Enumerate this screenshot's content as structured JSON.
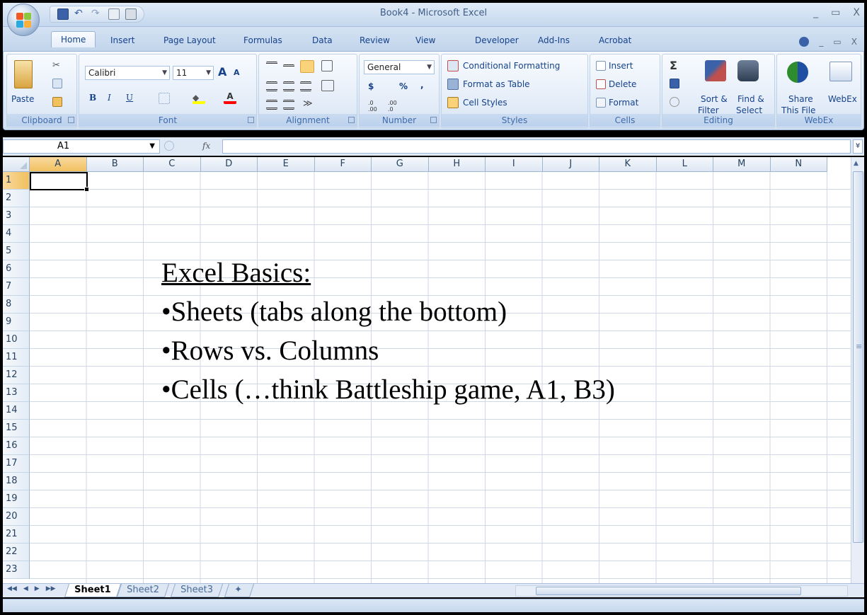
{
  "window": {
    "title": "Book4 - Microsoft Excel",
    "controls": [
      "_",
      "▭",
      "X"
    ]
  },
  "qat": {
    "icons": [
      "save-icon",
      "undo-icon",
      "redo-icon",
      "print-preview-icon",
      "quick-print-icon"
    ]
  },
  "tabs": [
    "Home",
    "Insert",
    "Page Layout",
    "Formulas",
    "Data",
    "Review",
    "View",
    "Developer",
    "Add-Ins",
    "Acrobat"
  ],
  "active_tab": "Home",
  "ribbon": {
    "clipboard": {
      "paste": "Paste",
      "label": "Clipboard"
    },
    "font": {
      "name": "Calibri",
      "size": "11",
      "label": "Font",
      "bold": "B",
      "italic": "I",
      "underline": "U",
      "grow": "A",
      "shrink": "A"
    },
    "alignment": {
      "label": "Alignment"
    },
    "number": {
      "format": "General",
      "label": "Number",
      "currency": "$",
      "percent": "%",
      "comma": ","
    },
    "styles": {
      "conditional": "Conditional Formatting",
      "format_table": "Format as Table",
      "cell_styles": "Cell Styles",
      "label": "Styles"
    },
    "cells": {
      "insert": "Insert",
      "delete": "Delete",
      "format": "Format",
      "label": "Cells"
    },
    "editing": {
      "sum": "Σ",
      "sort": "Sort &",
      "sort2": "Filter",
      "find": "Find &",
      "find2": "Select",
      "label": "Editing"
    },
    "webex": {
      "share": "Share",
      "share2": "This File",
      "webex": "WebEx",
      "label": "WebEx"
    }
  },
  "formula_bar": {
    "name_box": "A1",
    "fx": "fx",
    "value": ""
  },
  "columns": [
    "A",
    "B",
    "C",
    "D",
    "E",
    "F",
    "G",
    "H",
    "I",
    "J",
    "K",
    "L",
    "M",
    "N"
  ],
  "rows": [
    "1",
    "2",
    "3",
    "4",
    "5",
    "6",
    "7",
    "8",
    "9",
    "10",
    "11",
    "12",
    "13",
    "14",
    "15",
    "16",
    "17",
    "18",
    "19",
    "20",
    "21",
    "22",
    "23"
  ],
  "sheets": [
    "Sheet1",
    "Sheet2",
    "Sheet3"
  ],
  "active_sheet": "Sheet1",
  "overlay": {
    "heading": "Excel Basics:",
    "bullets": [
      "•Sheets (tabs along the bottom)",
      "•Rows vs. Columns",
      "•Cells (…think Battleship game, A1, B3)"
    ]
  }
}
